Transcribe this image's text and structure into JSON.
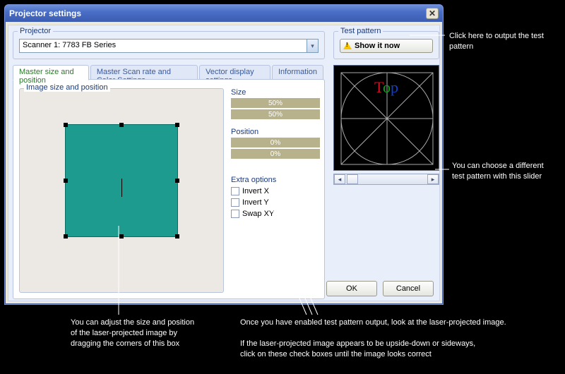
{
  "window": {
    "title": "Projector settings"
  },
  "projector": {
    "group_label": "Projector",
    "selected": "Scanner 1: 7783 FB Series"
  },
  "test_pattern": {
    "group_label": "Test pattern",
    "button_label": "Show it now",
    "tooltip": "Click here to output the test pattern",
    "slider_tooltip": "You can choose a different\ntest pattern with this slider",
    "top_text": {
      "r": "T",
      "g": "o",
      "b": "p"
    }
  },
  "tabs": [
    "Master size and position",
    "Master Scan rate and Color Settings",
    "Vector display settings",
    "Information"
  ],
  "active_tab": 0,
  "image_box": {
    "label": "Image size and position"
  },
  "size": {
    "label": "Size",
    "values": [
      "50%",
      "50%"
    ]
  },
  "position": {
    "label": "Position",
    "values": [
      "0%",
      "0%"
    ]
  },
  "extra": {
    "label": "Extra options",
    "options": [
      "Invert X",
      "Invert Y",
      "Swap XY"
    ]
  },
  "buttons": {
    "ok": "OK",
    "cancel": "Cancel"
  },
  "annotations": {
    "box_note": "You can adjust the size and position\nof the laser-projected image by\ndragging the corners of this box",
    "chk_note": "Once you have enabled test pattern output, look at the laser-projected image.\n\nIf the laser-projected image appears to be upside-down or sideways,\nclick on these check boxes until the image looks correct"
  }
}
